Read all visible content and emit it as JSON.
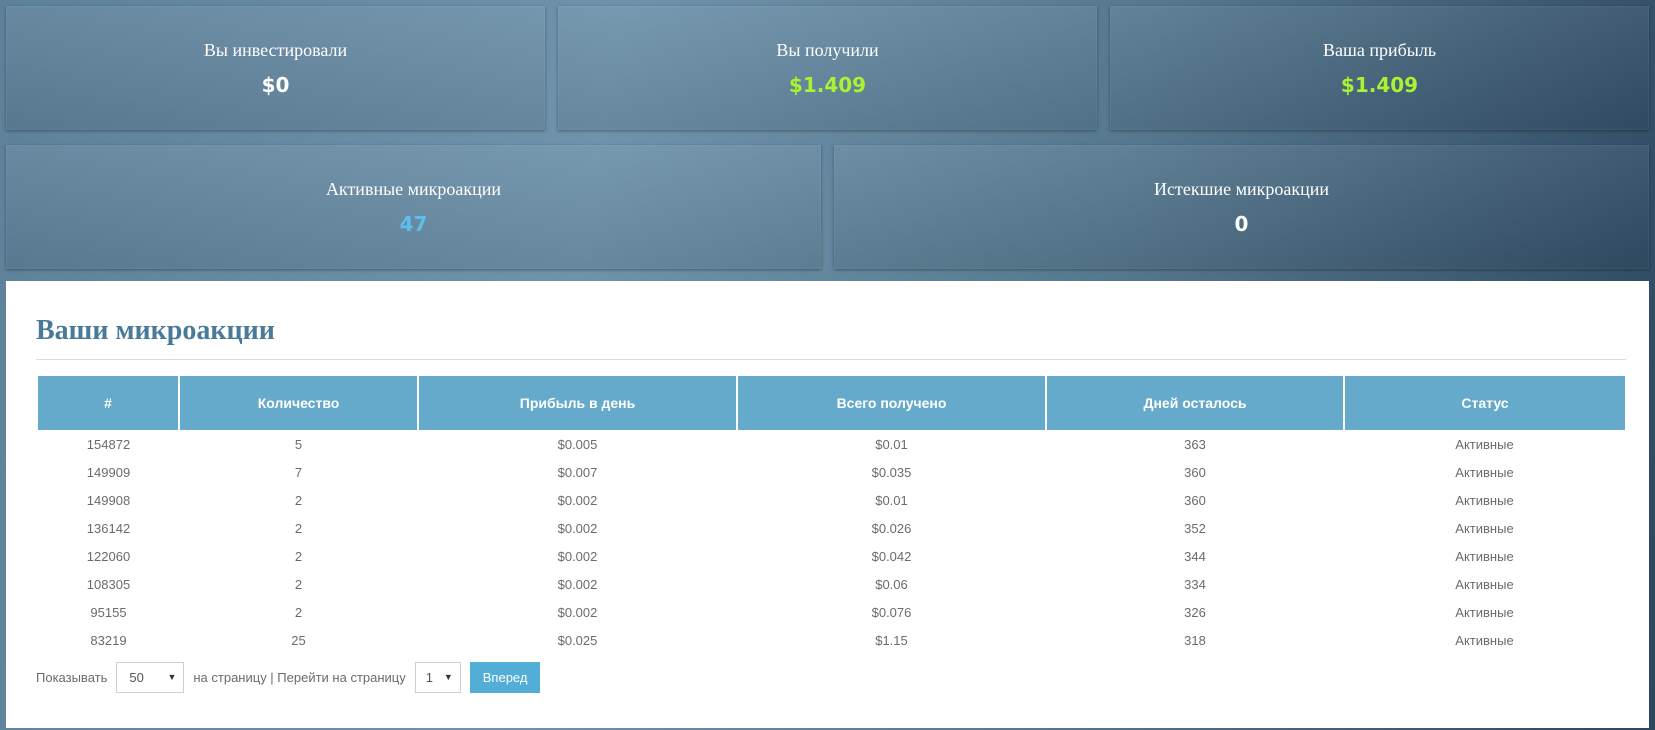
{
  "stats": {
    "invested": {
      "label": "Вы инвестировали",
      "value": "$0",
      "color": "#ffffff"
    },
    "received": {
      "label": "Вы получили",
      "value": "$1.409",
      "color": "#aaf333"
    },
    "profit": {
      "label": "Ваша прибыль",
      "value": "$1.409",
      "color": "#aaf333"
    },
    "active": {
      "label": "Активные микроакции",
      "value": "47",
      "color": "#5bc0ec"
    },
    "expired": {
      "label": "Истекшие микроакции",
      "value": "0",
      "color": "#ffffff"
    }
  },
  "panel": {
    "title": "Ваши микроакции",
    "columns": [
      "#",
      "Количество",
      "Прибыль в день",
      "Всего получено",
      "Дней осталось",
      "Статус"
    ],
    "rows": [
      [
        "154872",
        "5",
        "$0.005",
        "$0.01",
        "363",
        "Активные"
      ],
      [
        "149909",
        "7",
        "$0.007",
        "$0.035",
        "360",
        "Активные"
      ],
      [
        "149908",
        "2",
        "$0.002",
        "$0.01",
        "360",
        "Активные"
      ],
      [
        "136142",
        "2",
        "$0.002",
        "$0.026",
        "352",
        "Активные"
      ],
      [
        "122060",
        "2",
        "$0.002",
        "$0.042",
        "344",
        "Активные"
      ],
      [
        "108305",
        "2",
        "$0.002",
        "$0.06",
        "334",
        "Активные"
      ],
      [
        "95155",
        "2",
        "$0.002",
        "$0.076",
        "326",
        "Активные"
      ],
      [
        "83219",
        "25",
        "$0.025",
        "$1.15",
        "318",
        "Активные"
      ]
    ]
  },
  "pager": {
    "show_label": "Показывать",
    "per_page_value": "50",
    "per_page_label": "на страницу | Перейти на страницу",
    "page_value": "1",
    "next_label": "Вперед"
  },
  "colors": {
    "header_bg": "#65aacb",
    "button_bg": "#52aed6",
    "title_color": "#4a7a99"
  }
}
